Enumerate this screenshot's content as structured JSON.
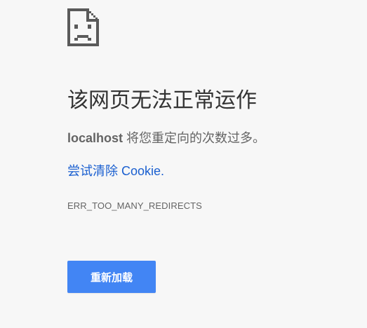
{
  "error": {
    "icon": "sad-page-icon",
    "title": "该网页无法正常运作",
    "host": "localhost",
    "message": " 将您重定向的次数过多。",
    "suggestion": "尝试清除 Cookie.",
    "code": "ERR_TOO_MANY_REDIRECTS",
    "reload_label": "重新加载"
  },
  "colors": {
    "background": "#f7f7f7",
    "link": "#1a5fd0",
    "button": "#4285f4",
    "icon": "#5a5a5a"
  }
}
